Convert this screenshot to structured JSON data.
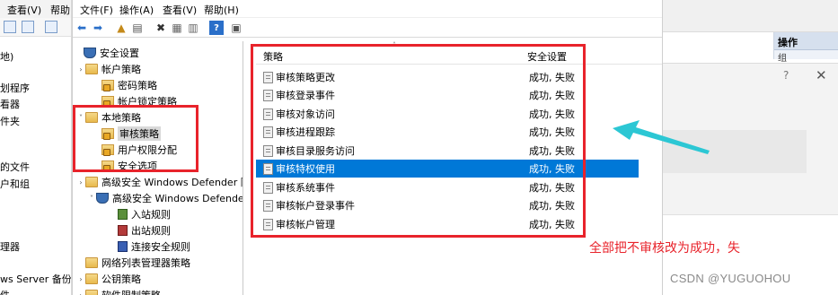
{
  "bg_window": {
    "menu": [
      "查看(V)",
      "帮助"
    ],
    "items": [
      "地)",
      "划程序",
      "看器",
      "件夹",
      "",
      "的文件",
      "户和组",
      "",
      "理器",
      "ws Server 备份",
      "件"
    ]
  },
  "main_window": {
    "menu": [
      "文件(F)",
      "操作(A)",
      "查看(V)",
      "帮助(H)"
    ],
    "tree": [
      {
        "label": "安全设置",
        "level": 0,
        "arrow": "",
        "icon": "shield"
      },
      {
        "label": "帐户策略",
        "level": 1,
        "arrow": "›",
        "icon": "folder"
      },
      {
        "label": "密码策略",
        "level": 2,
        "arrow": "",
        "icon": "lockfolder"
      },
      {
        "label": "帐户锁定策略",
        "level": 2,
        "arrow": "",
        "icon": "lockfolder"
      },
      {
        "label": "本地策略",
        "level": 1,
        "arrow": "˅",
        "icon": "folder"
      },
      {
        "label": "审核策略",
        "level": 2,
        "arrow": "",
        "icon": "lockfolder",
        "selected": true
      },
      {
        "label": "用户权限分配",
        "level": 2,
        "arrow": "",
        "icon": "lockfolder"
      },
      {
        "label": "安全选项",
        "level": 2,
        "arrow": "",
        "icon": "lockfolder"
      },
      {
        "label": "高级安全 Windows Defender 防火",
        "level": 1,
        "arrow": "›",
        "icon": "folder"
      },
      {
        "label": "高级安全 Windows Defender I",
        "level": 1,
        "arrow": "˅",
        "icon": "shield"
      },
      {
        "label": "入站规则",
        "level": 2,
        "arrow": "",
        "icon": "rule-green"
      },
      {
        "label": "出站规则",
        "level": 2,
        "arrow": "",
        "icon": "rule-red"
      },
      {
        "label": "连接安全规则",
        "level": 2,
        "arrow": "",
        "icon": "rule-blue"
      },
      {
        "label": "网络列表管理器策略",
        "level": 1,
        "arrow": "",
        "icon": "folder"
      },
      {
        "label": "公钥策略",
        "level": 1,
        "arrow": "›",
        "icon": "folder"
      },
      {
        "label": "软件限制策略",
        "level": 1,
        "arrow": "›",
        "icon": "folder"
      }
    ],
    "list": {
      "col_policy": "策略",
      "col_setting": "安全设置",
      "rows": [
        {
          "name": "审核策略更改",
          "value": "成功, 失败"
        },
        {
          "name": "审核登录事件",
          "value": "成功, 失败"
        },
        {
          "name": "审核对象访问",
          "value": "成功, 失败"
        },
        {
          "name": "审核进程跟踪",
          "value": "成功, 失败"
        },
        {
          "name": "审核目录服务访问",
          "value": "成功, 失败"
        },
        {
          "name": "审核特权使用",
          "value": "成功, 失败",
          "selected": true
        },
        {
          "name": "审核系统事件",
          "value": "成功, 失败"
        },
        {
          "name": "审核帐户登录事件",
          "value": "成功, 失败"
        },
        {
          "name": "审核帐户管理",
          "value": "成功, 失败"
        }
      ]
    }
  },
  "right_area": {
    "ops_header": "操作",
    "ops_sub": "组",
    "dialog_q": "?",
    "dialog_close": "✕"
  },
  "annotation": "全部把不审核改为成功，失",
  "watermark": "CSDN @YUGUOHOU",
  "colors": {
    "red": "#e8232b",
    "selection": "#0078d7",
    "arrow": "#2cc7d4"
  }
}
